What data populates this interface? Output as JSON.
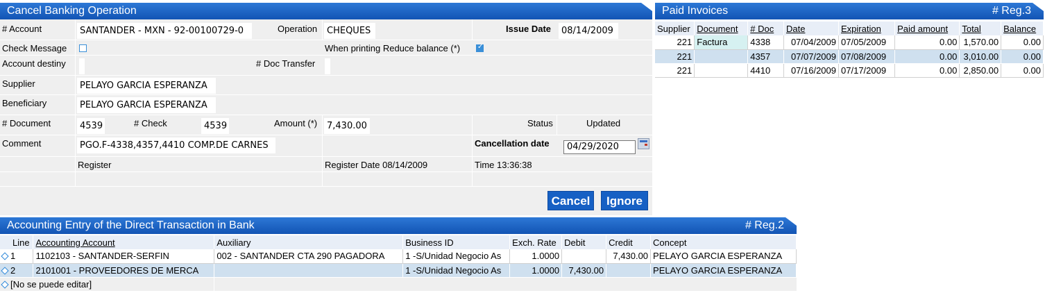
{
  "cancel_op": {
    "title": "Cancel Banking Operation",
    "account_label": "# Account",
    "account_value": "SANTANDER - MXN - 92-00100729-0",
    "operation_label": "Operation",
    "operation_value": "CHEQUES",
    "issue_date_label": "Issue Date",
    "issue_date_value": "08/14/2009",
    "check_message_label": "Check Message",
    "check_message_checked": false,
    "reduce_balance_label": "When printing Reduce balance (*)",
    "reduce_balance_checked": true,
    "account_destiny_label": "Account destiny",
    "doc_transfer_label": "# Doc Transfer",
    "supplier_label": "Supplier",
    "supplier_value": "PELAYO GARCIA ESPERANZA",
    "beneficiary_label": "Beneficiary",
    "beneficiary_value": "PELAYO GARCIA ESPERANZA",
    "document_label": "# Document",
    "document_value": "4539",
    "check_label": "# Check",
    "check_value": "4539",
    "amount_label": "Amount (*)",
    "amount_value": "7,430.00",
    "status_label": "Status",
    "status_value": "Updated",
    "comment_label": "Comment",
    "comment_value": "PGO.F-4338,4357,4410 COMP.DE CARNES",
    "cancellation_date_label": "Cancellation date",
    "cancellation_date_value": "04/29/2020",
    "register_label": "Register",
    "register_date_text": "Register Date 08/14/2009",
    "time_text": "Time 13:36:38",
    "cancel_button": "Cancel",
    "ignore_button": "Ignore"
  },
  "paid_invoices": {
    "title": "Paid Invoices",
    "reg": "# Reg.3",
    "columns": [
      "Supplier",
      "Document",
      "# Doc",
      "Date",
      "Expiration",
      "Paid amount",
      "Total",
      "Balance"
    ],
    "rows": [
      [
        "221",
        "Factura",
        "4338",
        "07/04/2009",
        "07/05/2009",
        "0.00",
        "1,570.00",
        "0.00"
      ],
      [
        "221",
        "",
        "4357",
        "07/07/2009",
        "07/08/2009",
        "0.00",
        "3,010.00",
        "0.00"
      ],
      [
        "221",
        "",
        "4410",
        "07/16/2009",
        "07/17/2009",
        "0.00",
        "2,850.00",
        "0.00"
      ]
    ]
  },
  "accounting": {
    "title": "Accounting Entry of the Direct Transaction in Bank",
    "reg": "# Reg.2",
    "columns": [
      "Line",
      "Accounting Account",
      "Auxiliary",
      "Business ID",
      "Exch. Rate",
      "Debit",
      "Credit",
      "Concept"
    ],
    "rows": [
      [
        "1",
        "1102103 - SANTANDER-SERFIN",
        "002 - SANTANDER CTA 290 PAGADORA",
        "1 -S/Unidad Negocio As",
        "1.0000",
        "",
        "7,430.00",
        "PELAYO GARCIA ESPERANZA"
      ],
      [
        "2",
        "2101001 - PROVEEDORES DE MERCA",
        "",
        "1 -S/Unidad Negocio As",
        "1.0000",
        "7,430.00",
        "",
        "PELAYO GARCIA ESPERANZA"
      ]
    ],
    "footer_note": "[No se puede editar]"
  }
}
